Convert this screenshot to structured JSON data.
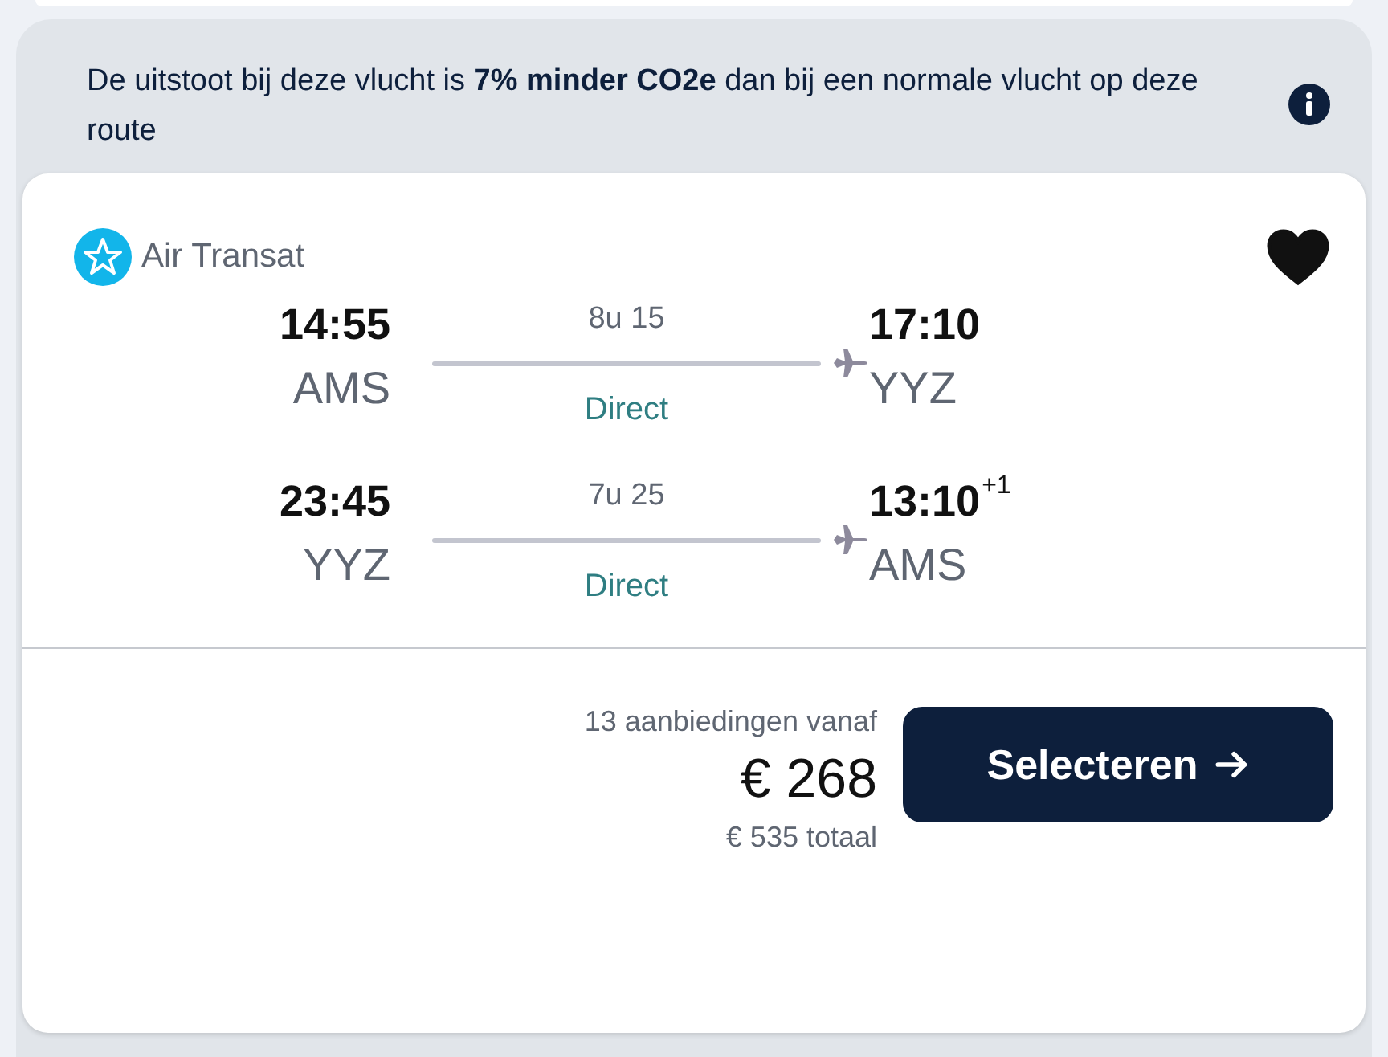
{
  "banner": {
    "text": "De uitstoot bij deze vlucht is **7% minder CO2e** dan bij een normale vlucht op deze route"
  },
  "card": {
    "airline": "Air Transat",
    "saved": true,
    "legs": [
      {
        "dep_time": "14:55",
        "dep_code": "AMS",
        "duration": "8u 15",
        "stops": "Direct",
        "arr_time": "17:10",
        "arr_code": "YYZ"
      },
      {
        "dep_time": "23:45",
        "dep_code": "YYZ",
        "duration": "7u 25",
        "stops": "Direct",
        "arr_time": "13:10",
        "day_offset": "+1",
        "arr_code": "AMS"
      }
    ],
    "offers": "13 aanbiedingen vanaf",
    "price": "€ 268",
    "total": "€ 535 totaal",
    "button": "Selecteren"
  }
}
